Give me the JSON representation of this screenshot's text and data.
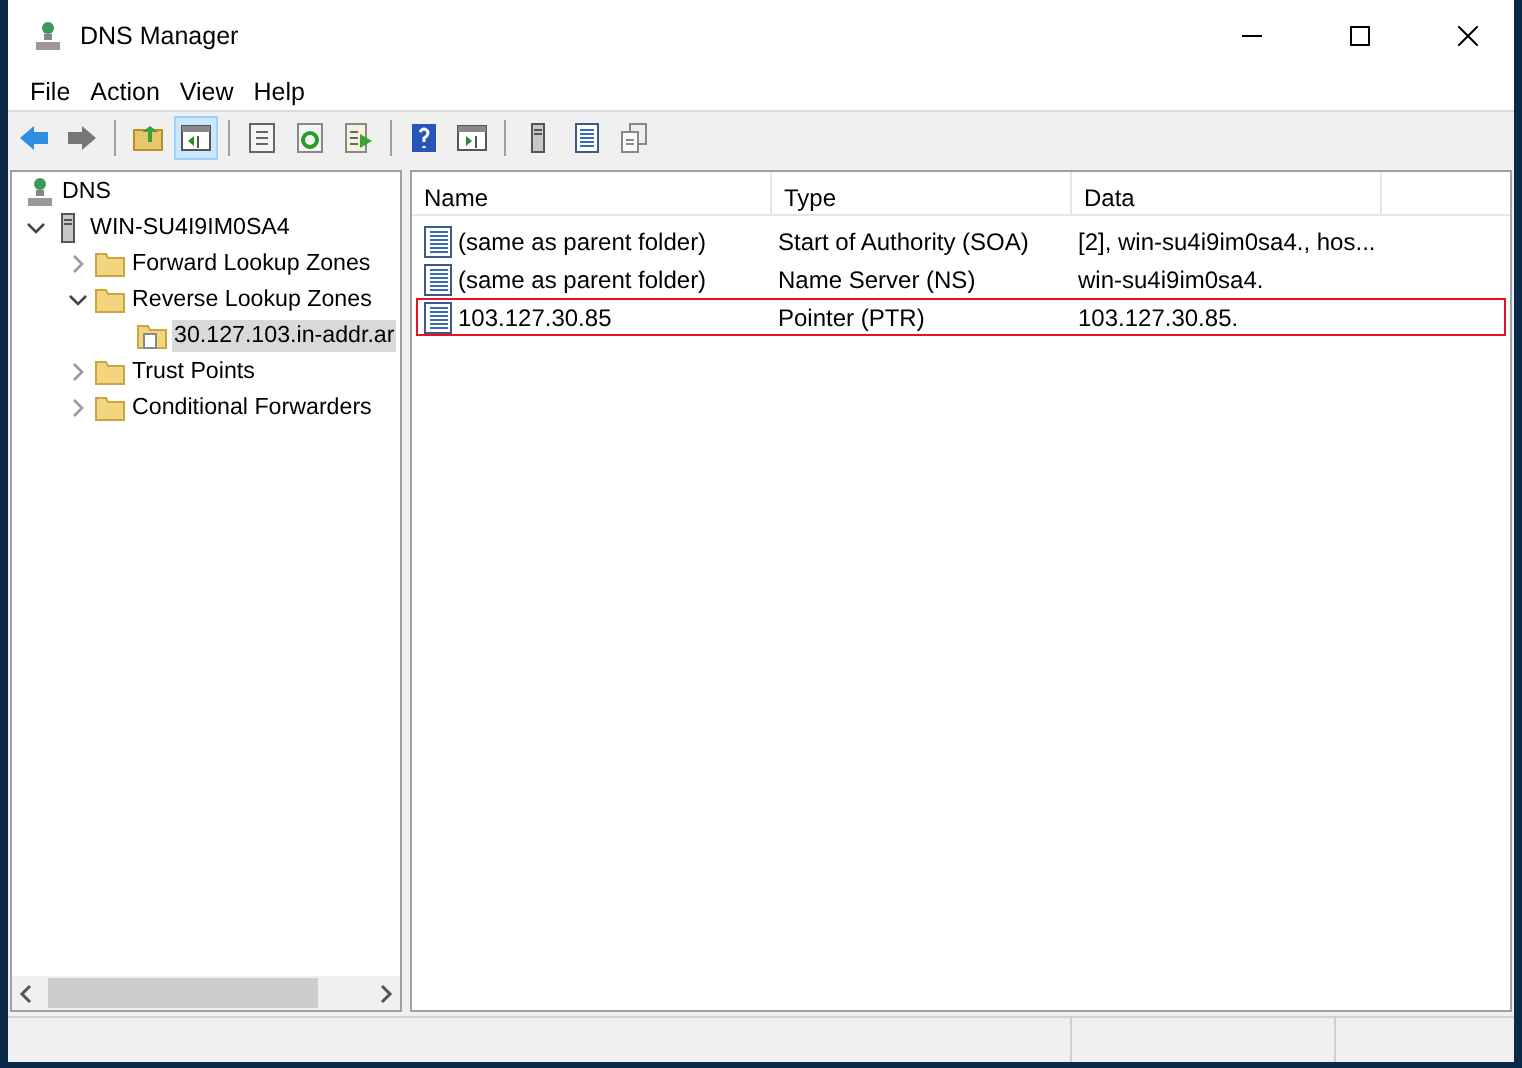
{
  "window": {
    "title": "DNS Manager"
  },
  "menu": [
    "File",
    "Action",
    "View",
    "Help"
  ],
  "toolbar": [
    {
      "kind": "back",
      "pressed": false
    },
    {
      "kind": "forward",
      "pressed": false
    },
    {
      "kind": "sep"
    },
    {
      "kind": "up",
      "pressed": false
    },
    {
      "kind": "tree",
      "pressed": true
    },
    {
      "kind": "sep"
    },
    {
      "kind": "props",
      "pressed": false
    },
    {
      "kind": "refresh",
      "pressed": false
    },
    {
      "kind": "export",
      "pressed": false
    },
    {
      "kind": "sep"
    },
    {
      "kind": "help",
      "pressed": false
    },
    {
      "kind": "pane",
      "pressed": false
    },
    {
      "kind": "sep"
    },
    {
      "kind": "server",
      "pressed": false
    },
    {
      "kind": "record",
      "pressed": false
    },
    {
      "kind": "copy",
      "pressed": false
    }
  ],
  "tree": [
    {
      "label": "DNS",
      "kind": "dns",
      "expanded": true,
      "selected": false,
      "children": [
        {
          "label": "WIN-SU4I9IM0SA4",
          "kind": "server",
          "expanded": true,
          "selected": false,
          "children": [
            {
              "label": "Forward Lookup Zones",
              "kind": "folder",
              "expanded": false,
              "selected": false
            },
            {
              "label": "Reverse Lookup Zones",
              "kind": "folder",
              "expanded": true,
              "selected": false,
              "children": [
                {
                  "label": "30.127.103.in-addr.ar",
                  "kind": "zone",
                  "selected": true
                }
              ]
            },
            {
              "label": "Trust Points",
              "kind": "folder",
              "expanded": false,
              "selected": false
            },
            {
              "label": "Conditional Forwarders",
              "kind": "folder",
              "expanded": false,
              "selected": false
            }
          ]
        }
      ]
    }
  ],
  "table": {
    "columns": [
      "Name",
      "Type",
      "Data"
    ],
    "rows": [
      {
        "name": "(same as parent folder)",
        "type": "Start of Authority (SOA)",
        "data": "[2], win-su4i9im0sa4., hos...",
        "highlighted": false
      },
      {
        "name": "(same as parent folder)",
        "type": "Name Server (NS)",
        "data": "win-su4i9im0sa4.",
        "highlighted": false
      },
      {
        "name": "103.127.30.85",
        "type": "Pointer (PTR)",
        "data": "103.127.30.85.",
        "highlighted": true
      }
    ]
  }
}
